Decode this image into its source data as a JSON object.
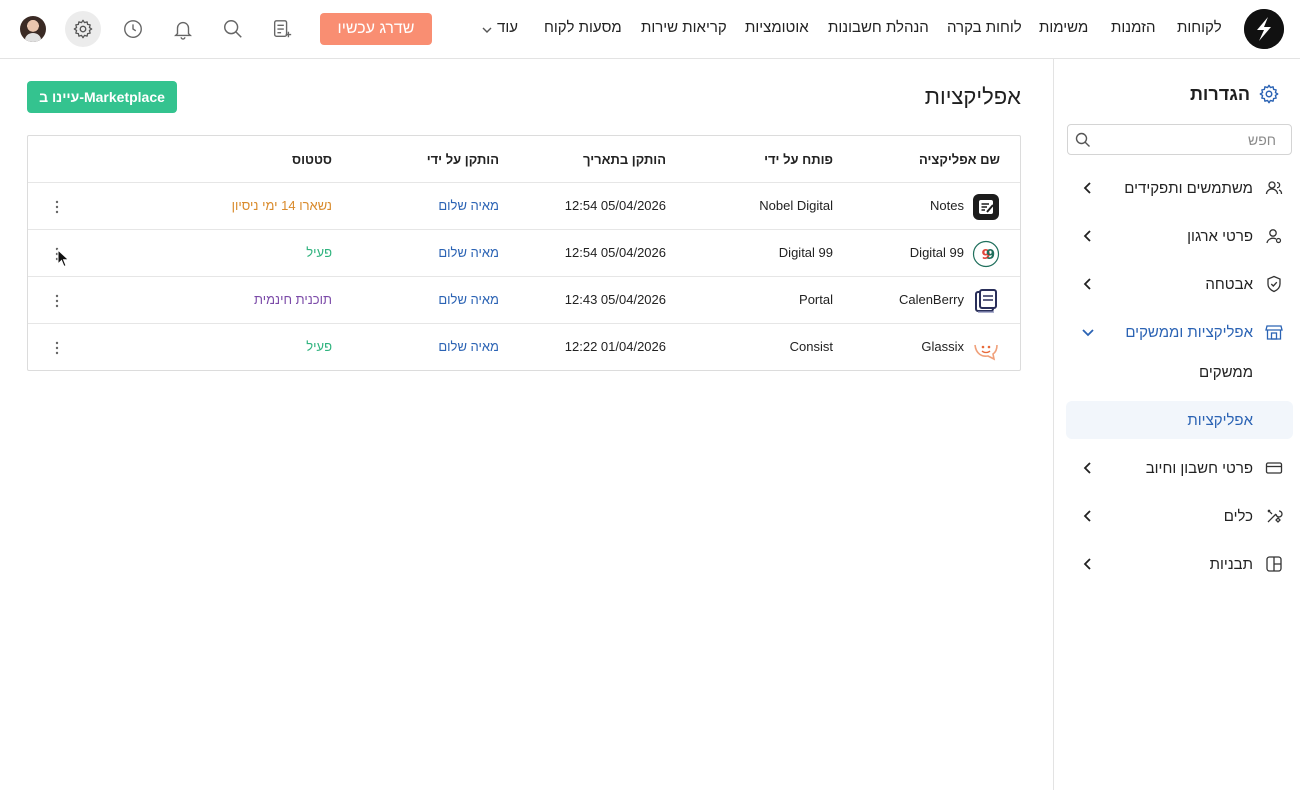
{
  "topbar": {
    "nav": [
      {
        "key": "customers",
        "label": "לקוחות"
      },
      {
        "key": "orders",
        "label": "הזמנות"
      },
      {
        "key": "tasks",
        "label": "משימות"
      },
      {
        "key": "dashboards",
        "label": "לוחות בקרה"
      },
      {
        "key": "bookkeeping",
        "label": "הנהלת חשבונות"
      },
      {
        "key": "automations",
        "label": "אוטומציות"
      },
      {
        "key": "service-calls",
        "label": "קריאות שירות"
      },
      {
        "key": "customer-journeys",
        "label": "מסעות לקוח"
      },
      {
        "key": "more",
        "label": "עוד"
      }
    ],
    "upgrade_label": "שדרג עכשיו",
    "icons": [
      "note-add-icon",
      "search-icon",
      "bell-icon",
      "clock-icon",
      "gear-icon",
      "avatar"
    ]
  },
  "sidebar": {
    "title": "הגדרות",
    "search_placeholder": "חפש",
    "items": [
      {
        "label": "משתמשים ותפקידים",
        "icon": "users-icon"
      },
      {
        "label": "פרטי ארגון",
        "icon": "user-settings-icon"
      },
      {
        "label": "אבטחה",
        "icon": "shield-icon"
      },
      {
        "label": "אפליקציות וממשקים",
        "icon": "store-icon",
        "expanded": true
      },
      {
        "label": "פרטי חשבון וחיוב",
        "icon": "credit-card-icon"
      },
      {
        "label": "כלים",
        "icon": "tools-icon"
      },
      {
        "label": "תבניות",
        "icon": "layout-icon"
      }
    ],
    "subitems": [
      {
        "label": "ממשקים",
        "active": false
      },
      {
        "label": "אפליקציות",
        "active": true
      }
    ]
  },
  "main": {
    "title": "אפליקציות",
    "marketplace_label": "עיינו ב-Marketplace",
    "table": {
      "headers": {
        "name": "שם אפליקציה",
        "developer": "פותח על ידי",
        "installed_at": "הותקן בתאריך",
        "installed_by": "הותקן על ידי",
        "status": "סטטוס"
      },
      "rows": [
        {
          "name": "Notes",
          "icon": "notes-app-icon",
          "developer": "Nobel Digital",
          "installed_at": "12:54 05/04/2026",
          "installed_by": "מאיה שלום",
          "status": "נשארו 14 ימי ניסיון",
          "status_type": "trial"
        },
        {
          "name": "Digital 99",
          "icon": "digital99-app-icon",
          "developer": "Digital 99",
          "installed_at": "12:54 05/04/2026",
          "installed_by": "מאיה שלום",
          "status": "פעיל",
          "status_type": "active"
        },
        {
          "name": "CalenBerry",
          "icon": "calenberry-app-icon",
          "developer": "Portal",
          "installed_at": "12:43 05/04/2026",
          "installed_by": "מאיה שלום",
          "status": "תוכנית חינמית",
          "status_type": "free"
        },
        {
          "name": "Glassix",
          "icon": "glassix-app-icon",
          "developer": "Consist",
          "installed_at": "12:22 01/04/2026",
          "installed_by": "מאיה שלום",
          "status": "פעיל",
          "status_type": "active"
        }
      ]
    }
  },
  "colors": {
    "accent_blue": "#2b63b4",
    "upgrade_orange": "#f98e72",
    "marketplace_green": "#34c38f",
    "status_trial": "#d98a2b",
    "status_active": "#2fb37e",
    "status_free": "#7b4aa8"
  }
}
